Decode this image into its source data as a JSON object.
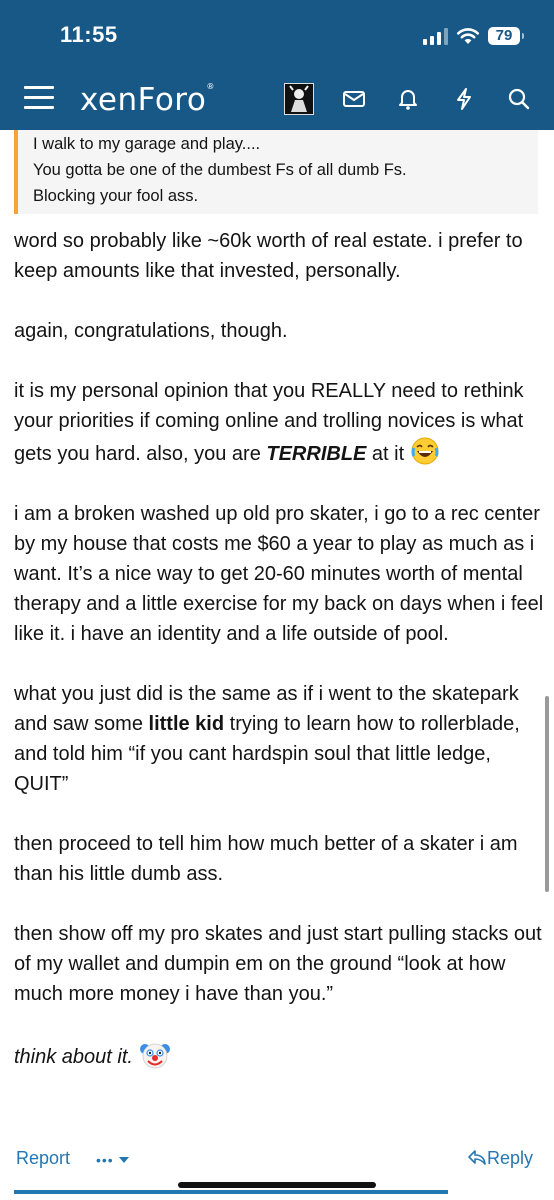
{
  "status_bar": {
    "time": "11:55",
    "battery": "79"
  },
  "header": {
    "logo_text": "xenForo",
    "logo_mark": "®"
  },
  "nav_icons": [
    "avatar",
    "envelope-icon",
    "bell-icon",
    "lightning-icon",
    "search-icon"
  ],
  "quote": {
    "lines": [
      "I walk to my garage and play....",
      "You gotta be one of the dumbest Fs of all dumb Fs.",
      "Blocking your fool ass."
    ]
  },
  "post": {
    "p1": "word so probably like ~60k worth of real estate. i prefer to keep amounts like that invested, personally.",
    "p2": "again, congratulations, though.",
    "p3a": "it is my personal opinion that you REALLY need to rethink your priorities if coming online and trolling novices is what gets you hard. also, you are ",
    "p3_bold": "TERRIBLE",
    "p3b": " at it",
    "p4": "i am a broken washed up old pro skater, i go to a rec center by my house that costs me $60 a year to play as much as i want. It’s a nice way to get 20-60 minutes worth of mental therapy and a little exercise for my back on days when i feel like it. i have an identity and a life outside of pool.",
    "p5a": "what you just did is the same as if i went to the skatepark and saw some ",
    "p5_bold": "little kid",
    "p5b": " trying to learn how to rollerblade, and told him “if you cant hardspin soul that little ledge, QUIT”",
    "p6": "then proceed to tell him how much better of a skater i am than his little dumb ass.",
    "p7": "then show off my pro skates and just start pulling stacks out of my wallet and dumpin em on the ground “look at how much more money i have than you.”",
    "p8": "think about it."
  },
  "footer": {
    "report": "Report",
    "more": "•••",
    "reply": "Reply"
  },
  "colors": {
    "header": "#185886",
    "link": "#2577b1",
    "quote_border": "#f7a434"
  }
}
